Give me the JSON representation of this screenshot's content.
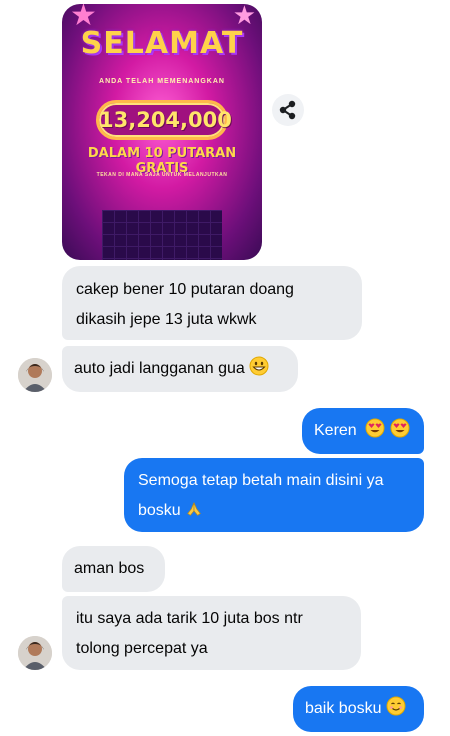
{
  "image_message": {
    "title": "SELAMAT",
    "subtitle": "ANDA TELAH MEMENANGKAN",
    "amount": "13,204,000",
    "headline": "DALAM 10 PUTARAN GRATIS",
    "footnote": "TEKAN DI MANA SAJA UNTUK MELANJUTKAN"
  },
  "messages": [
    {
      "side": "in",
      "text": "cakep bener 10 putaran doang dikasih jepe 13 juta wkwk"
    },
    {
      "side": "in",
      "text": "auto jadi langganan gua",
      "emoji": "grinning-face-emoji"
    },
    {
      "side": "out",
      "text": "Keren",
      "emoji": "heart-eyes-emoji x2"
    },
    {
      "side": "out",
      "text": "Semoga tetap betah main disini ya bosku",
      "emoji": "folded-hands-emoji"
    },
    {
      "side": "in",
      "text": "aman bos"
    },
    {
      "side": "in",
      "text": "itu saya ada tarik 10 juta bos ntr tolong percepat ya"
    },
    {
      "side": "out",
      "text": "baik bosku",
      "emoji": "smiling-face-emoji"
    }
  ],
  "icons": {
    "share": "share-icon"
  },
  "colors": {
    "outgoing": "#1877f2",
    "incoming": "#e9ebee",
    "text": "#050505"
  }
}
